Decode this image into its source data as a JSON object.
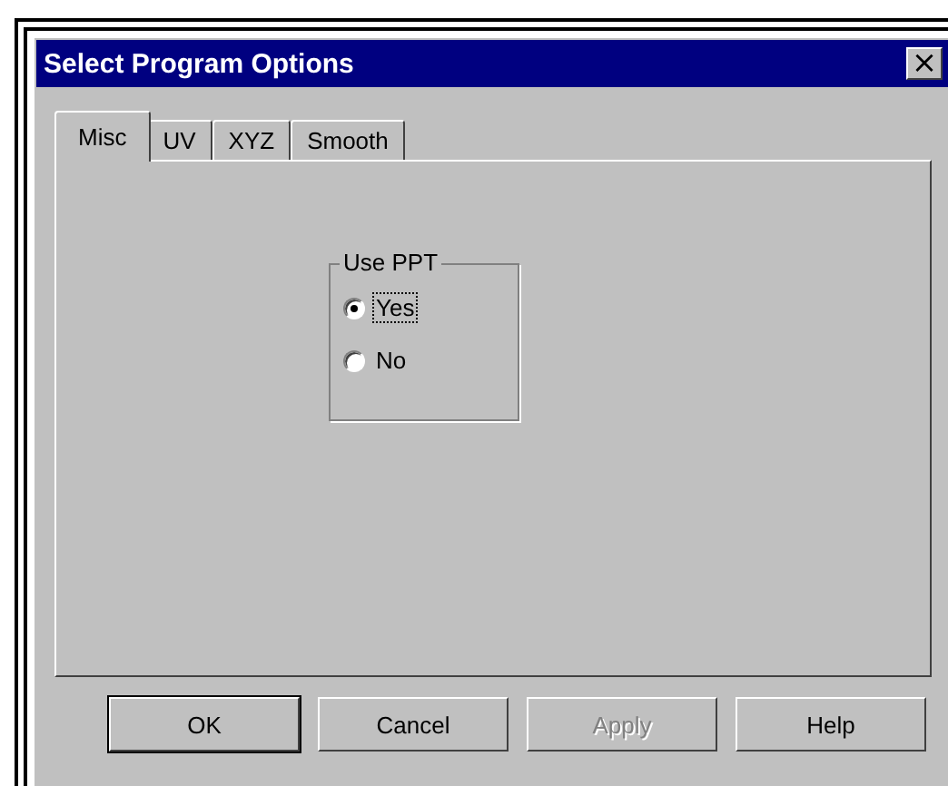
{
  "window": {
    "title": "Select Program Options",
    "close": "×"
  },
  "tabs": [
    {
      "label": "Misc",
      "selected": true
    },
    {
      "label": "UV",
      "selected": false
    },
    {
      "label": "XYZ",
      "selected": false
    },
    {
      "label": "Smooth",
      "selected": false
    }
  ],
  "group": {
    "title": "Use PPT",
    "options": [
      {
        "label": "Yes",
        "selected": true
      },
      {
        "label": "No",
        "selected": false
      }
    ]
  },
  "buttons": [
    {
      "label": "OK",
      "disabled": false,
      "default": true
    },
    {
      "label": "Cancel",
      "disabled": false,
      "default": false
    },
    {
      "label": "Apply",
      "disabled": true,
      "default": false
    },
    {
      "label": "Help",
      "disabled": false,
      "default": false
    }
  ]
}
